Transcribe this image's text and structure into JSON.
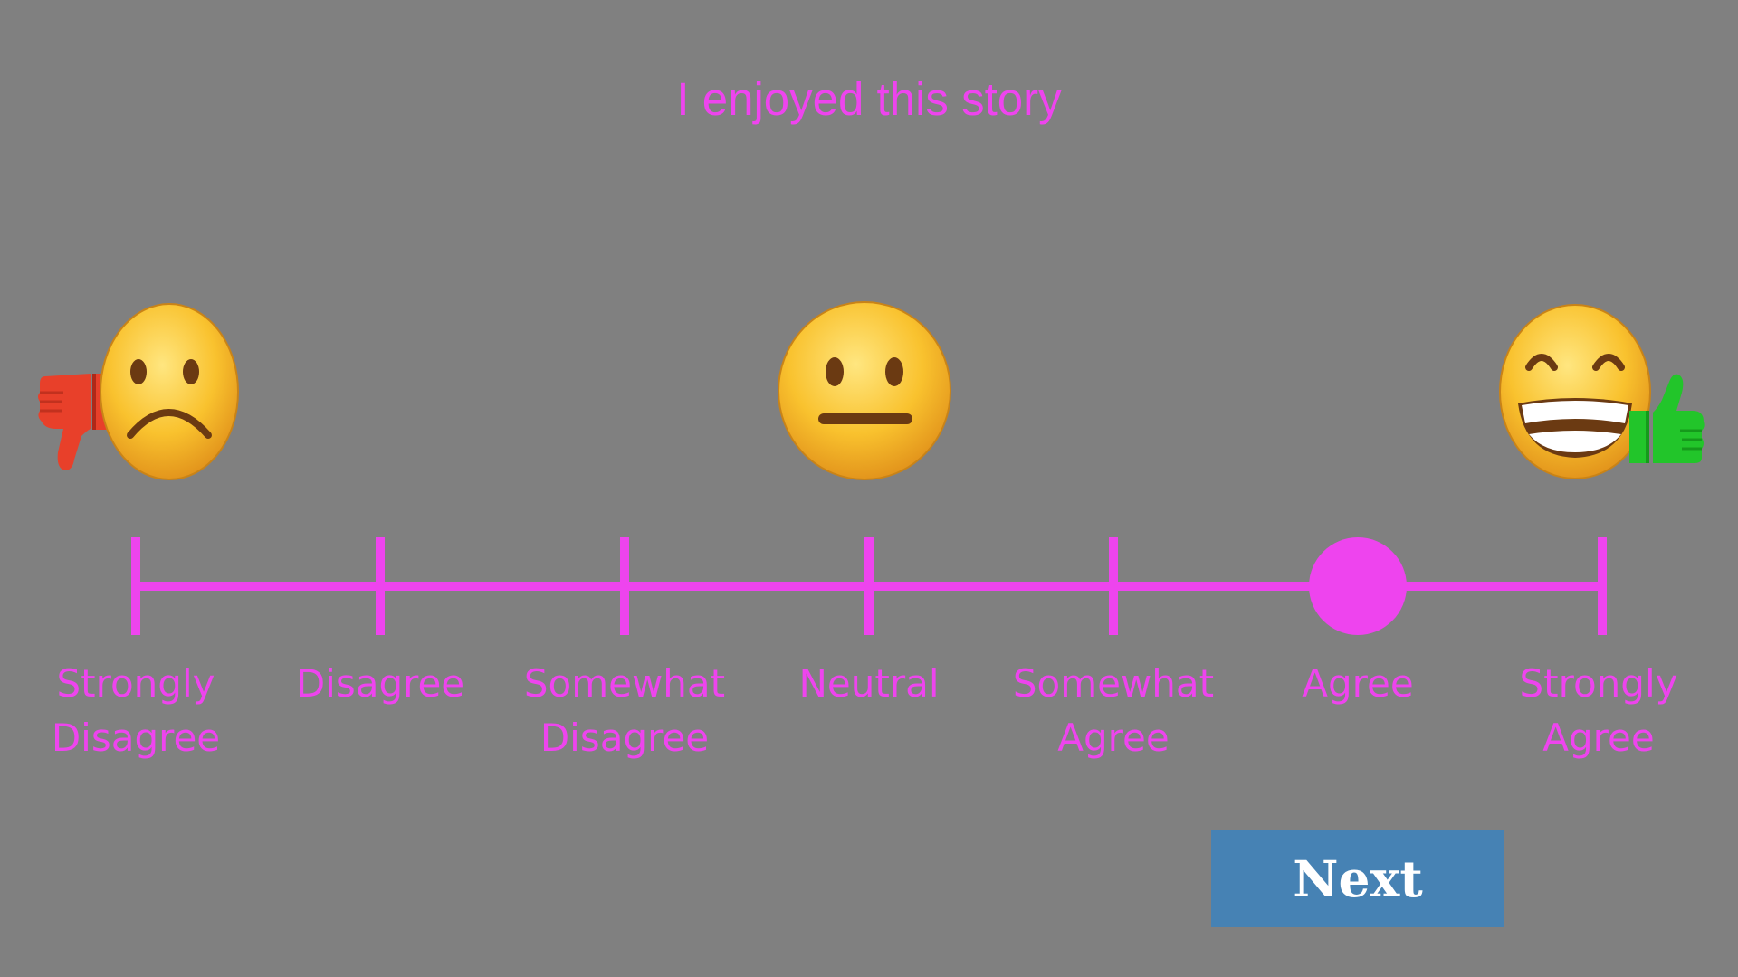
{
  "question": "I enjoyed this story",
  "scale": {
    "options": [
      {
        "label": "Strongly\nDisagree"
      },
      {
        "label": "Disagree"
      },
      {
        "label": "Somewhat\nDisagree"
      },
      {
        "label": "Neutral"
      },
      {
        "label": "Somewhat\nAgree"
      },
      {
        "label": "Agree"
      },
      {
        "label": "Strongly\nAgree"
      }
    ],
    "selected_index": 5,
    "selected_label": "Agree"
  },
  "icons": {
    "left": [
      "thumbs-down-icon",
      "frowning-face-icon"
    ],
    "center": [
      "neutral-face-icon"
    ],
    "right": [
      "grinning-face-icon",
      "thumbs-up-icon"
    ]
  },
  "next_button": {
    "label": "Next"
  },
  "colors": {
    "background": "#808080",
    "accent": "#ee44ee",
    "button": "#4682b4",
    "button_text": "#ffffff",
    "thumbs_down": "#e8402a",
    "thumbs_up": "#22c52a"
  }
}
